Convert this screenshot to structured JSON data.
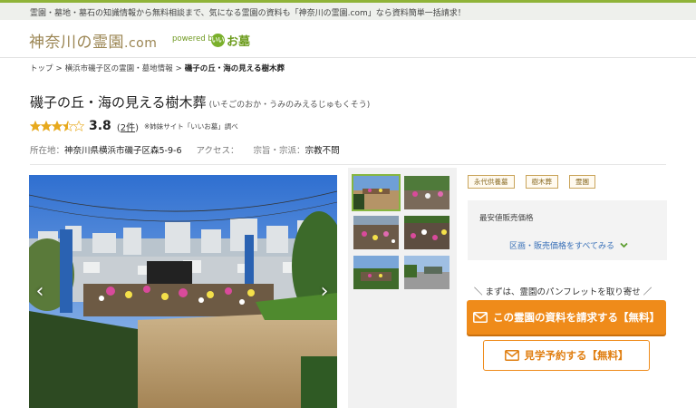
{
  "topbar": {
    "text": "霊園・墓地・墓石の知識情報から無料相談まで、気になる霊園の資料も「神奈川の霊園.com」なら資料簡単一括請求！"
  },
  "header": {
    "logo_main": "神奈川の霊園",
    "logo_suffix": ".com",
    "powered_by": "powered by",
    "partner_badge": "いい",
    "partner_name": "お墓"
  },
  "breadcrumb": {
    "items": [
      "トップ",
      "横浜市磯子区の霊園・墓地情報"
    ],
    "separator": ">",
    "current": "磯子の丘・海の見える樹木葬"
  },
  "title": {
    "name": "磯子の丘・海の見える樹木葬",
    "reading": "(いそごのおか・うみのみえるじゅもくそう)"
  },
  "rating": {
    "stars_value": 3.5,
    "score": "3.8",
    "reviews_open": "(",
    "reviews_link": "2件",
    "reviews_close": ")",
    "note": "※姉妹サイト「いいお墓」調べ"
  },
  "info": {
    "address_label": "所在地：",
    "address": "神奈川県横浜市磯子区森5-9-6",
    "access_label": "アクセス：",
    "access": "",
    "religion_label": "宗旨・宗派：",
    "religion": "宗教不問"
  },
  "gallery": {
    "prev_icon": "‹",
    "next_icon": "›"
  },
  "tags": [
    "永代供養墓",
    "樹木葬",
    "霊園"
  ],
  "price": {
    "label": "最安値販売価格",
    "link": "区画・販売価格をすべてみる",
    "chevron": "⌄"
  },
  "cta": {
    "caption": "＼ まずは、霊園のパンフレットを取り寄せ ／",
    "request_label": "この霊園の資料を請求する【無料】",
    "tour_label": "見学予約する【無料】"
  },
  "colors": {
    "accent_green": "#8fb338",
    "cta_orange": "#ef8b1a",
    "link_blue": "#3a71b8",
    "logo_brown": "#9a8451"
  }
}
